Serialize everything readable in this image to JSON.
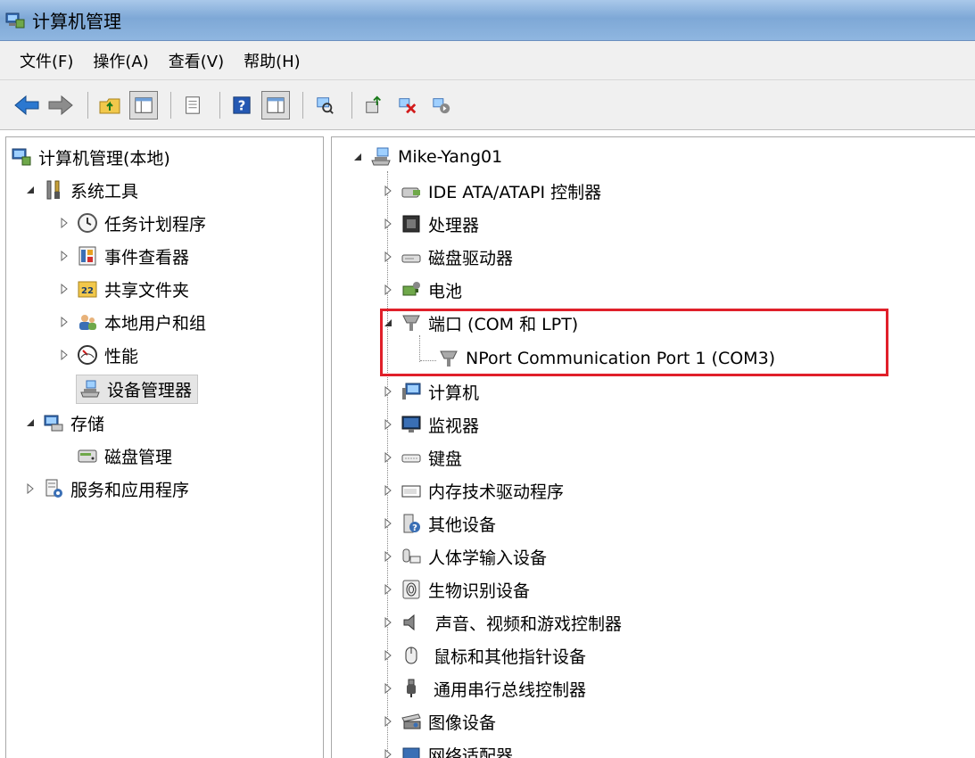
{
  "window": {
    "title": "计算机管理"
  },
  "menu": [
    "文件(F)",
    "操作(A)",
    "查看(V)",
    "帮助(H)"
  ],
  "left_tree": {
    "root": "计算机管理(本地)",
    "system_tools": "系统工具",
    "task_scheduler": "任务计划程序",
    "event_viewer": "事件查看器",
    "shared_folders": "共享文件夹",
    "local_users": "本地用户和组",
    "performance": "性能",
    "device_manager": "设备管理器",
    "storage": "存储",
    "disk_management": "磁盘管理",
    "services": "服务和应用程序"
  },
  "right_tree": {
    "computer": "Mike-Yang01",
    "ide": "IDE ATA/ATAPI 控制器",
    "processor": "处理器",
    "disk_drives": "磁盘驱动器",
    "battery": "电池",
    "ports": "端口 (COM 和 LPT)",
    "nport": "NPort Communication Port 1 (COM3)",
    "computer_cat": "计算机",
    "monitors": "监视器",
    "keyboard": "键盘",
    "memory": "内存技术驱动程序",
    "other": "其他设备",
    "hid": "人体学输入设备",
    "biometric": "生物识别设备",
    "sound": "声音、视频和游戏控制器",
    "mouse": "鼠标和其他指针设备",
    "usb": "通用串行总线控制器",
    "imaging": "图像设备",
    "network": "网络适配器"
  },
  "colors": {
    "highlight": "#e0202a",
    "title_gradient": "#7ea8d6"
  }
}
